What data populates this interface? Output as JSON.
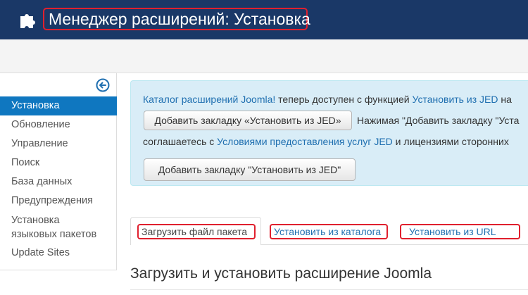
{
  "header": {
    "title": "Менеджер расширений: Установка",
    "icon": "puzzle-icon",
    "background": "#1a3867"
  },
  "sidebar": {
    "collapse_icon": "arrow-left-circle-icon",
    "items": [
      {
        "label": "Установка",
        "active": true
      },
      {
        "label": "Обновление"
      },
      {
        "label": "Управление"
      },
      {
        "label": "Поиск"
      },
      {
        "label": "База данных"
      },
      {
        "label": "Предупреждения"
      },
      {
        "label_line1": "Установка",
        "label_line2": "языковых пакетов"
      },
      {
        "label": "Update Sites"
      }
    ],
    "active_color": "#0f77c0"
  },
  "notice": {
    "line1_link1": "Каталог расширений Joomla!",
    "line1_text": " теперь доступен с функцией ",
    "line1_link2": "Установить из JED",
    "line1_tail": " на",
    "add_tab_inline": "Добавить закладку «Установить из JED»",
    "line2_text": "Нажимая \"Добавить закладку \"Уста",
    "line3_text1": "соглашаетесь с ",
    "line3_link": "Условиями предоставления услуг JED",
    "line3_text2": " и лицензиями сторонних",
    "add_tab_button": "Добавить закладку \"Установить из JED\"",
    "background": "#d9edf7"
  },
  "tabs": [
    {
      "label": "Загрузить файл пакета",
      "active": true
    },
    {
      "label": "Установить из каталога"
    },
    {
      "label": "Установить из URL"
    }
  ],
  "section": {
    "title": "Загрузить и установить расширение Joomla"
  },
  "highlight_color": "#e0202e"
}
